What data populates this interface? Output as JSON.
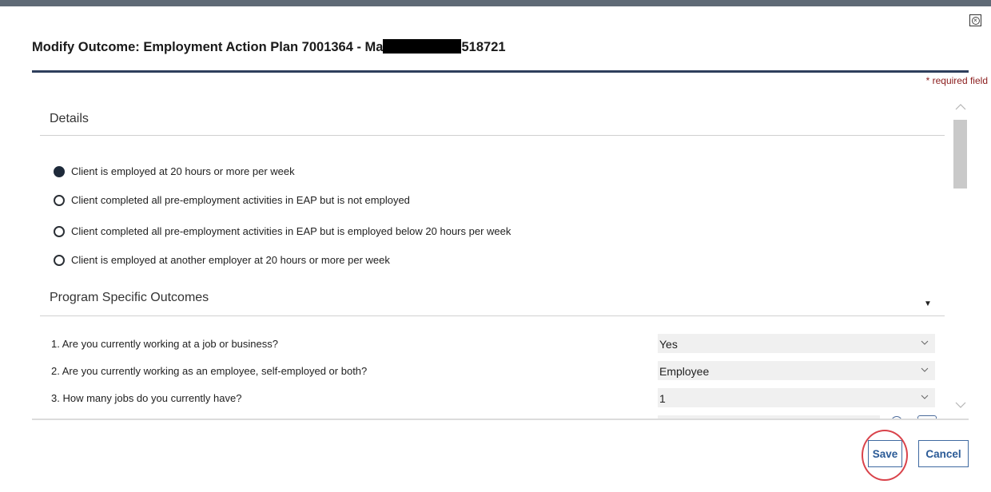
{
  "dialog": {
    "title_prefix": "Modify Outcome: Employment Action Plan 7001364 - Ma",
    "title_suffix": "518721",
    "required_note": "* required field"
  },
  "details": {
    "heading": "Details",
    "options": [
      {
        "label": "Client is employed at 20 hours or more per week",
        "selected": true
      },
      {
        "label": "Client completed all pre-employment activities in EAP but is not employed",
        "selected": false
      },
      {
        "label": "Client completed all pre-employment activities in EAP but is employed below 20 hours per week",
        "selected": false
      },
      {
        "label": "Client is employed at another employer at 20 hours or more per week",
        "selected": false
      }
    ]
  },
  "program": {
    "heading": "Program Specific Outcomes",
    "questions": [
      {
        "label": "1. Are you currently working at a job or business?",
        "value": "Yes"
      },
      {
        "label": "2. Are you currently working as an employee, self-employed or both?",
        "value": "Employee"
      },
      {
        "label": "3. How many jobs do you currently have?",
        "value": "1"
      }
    ]
  },
  "footer": {
    "save_label": "Save",
    "cancel_label": "Cancel"
  },
  "colors": {
    "accent": "#2e3f5c",
    "required": "#8a1b1b",
    "button_text": "#2a5a96",
    "highlight": "#d9434b"
  },
  "icons": [
    "close-icon",
    "chevron-down-icon",
    "collapse-arrow-icon",
    "scroll-up-icon",
    "scroll-down-icon"
  ]
}
